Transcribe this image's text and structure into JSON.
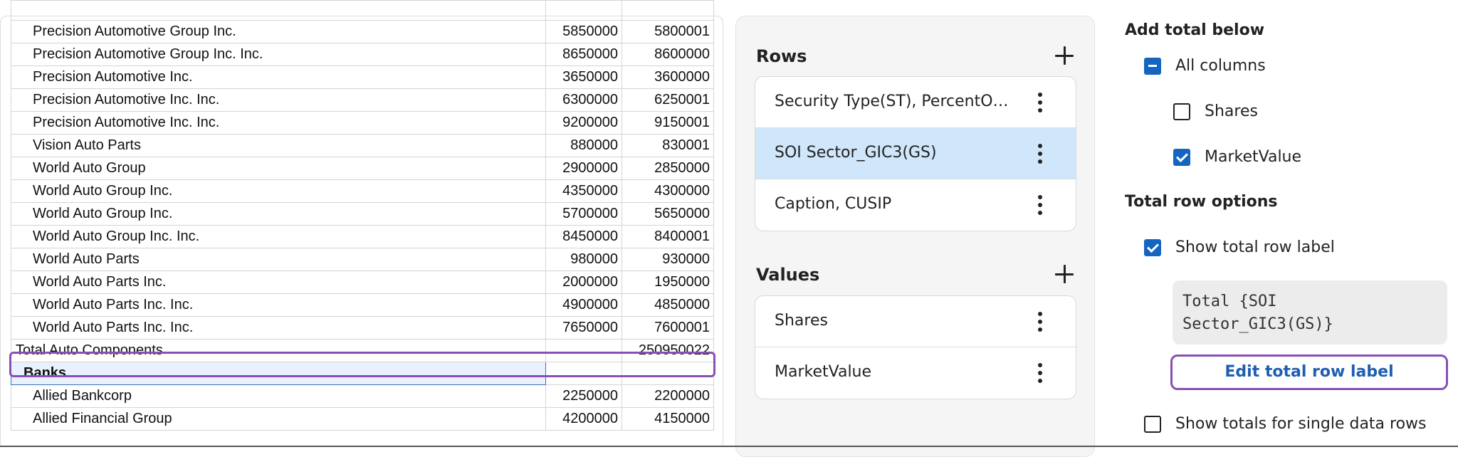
{
  "table": {
    "partial_row": {
      "name": "",
      "shares": "",
      "market_value": ""
    },
    "rows": [
      {
        "name": "Precision Automotive Group Inc.",
        "shares": "5850000",
        "market_value": "5800001"
      },
      {
        "name": "Precision Automotive Group Inc. Inc.",
        "shares": "8650000",
        "market_value": "8600000"
      },
      {
        "name": "Precision Automotive Inc.",
        "shares": "3650000",
        "market_value": "3600000"
      },
      {
        "name": "Precision Automotive Inc. Inc.",
        "shares": "6300000",
        "market_value": "6250001"
      },
      {
        "name": "Precision Automotive Inc. Inc.",
        "shares": "9200000",
        "market_value": "9150001"
      },
      {
        "name": "Vision Auto Parts",
        "shares": "880000",
        "market_value": "830001"
      },
      {
        "name": "World Auto Group",
        "shares": "2900000",
        "market_value": "2850000"
      },
      {
        "name": "World Auto Group Inc.",
        "shares": "4350000",
        "market_value": "4300000"
      },
      {
        "name": "World Auto Group Inc.",
        "shares": "5700000",
        "market_value": "5650000"
      },
      {
        "name": "World Auto Group Inc. Inc.",
        "shares": "8450000",
        "market_value": "8400001"
      },
      {
        "name": "World Auto Parts",
        "shares": "980000",
        "market_value": "930000"
      },
      {
        "name": "World Auto Parts Inc.",
        "shares": "2000000",
        "market_value": "1950000"
      },
      {
        "name": "World Auto Parts Inc. Inc.",
        "shares": "4900000",
        "market_value": "4850000"
      },
      {
        "name": "World Auto Parts Inc. Inc.",
        "shares": "7650000",
        "market_value": "7600001"
      }
    ],
    "total_row": {
      "name": "Total Auto Components",
      "shares": "",
      "market_value": "250950022"
    },
    "group_row": {
      "name": "Banks"
    },
    "after_rows": [
      {
        "name": "Allied Bankcorp",
        "shares": "2250000",
        "market_value": "2200000"
      },
      {
        "name": "Allied Financial Group",
        "shares": "4200000",
        "market_value": "4150000"
      }
    ]
  },
  "config": {
    "rows_title": "Rows",
    "rows": [
      {
        "label": "Security Type(ST), PercentOfNetAssets",
        "selected": false
      },
      {
        "label": "SOI Sector_GIC3(GS)",
        "selected": true
      },
      {
        "label": "Caption, CUSIP",
        "selected": false
      }
    ],
    "values_title": "Values",
    "values": [
      {
        "label": "Shares"
      },
      {
        "label": "MarketValue"
      }
    ]
  },
  "options": {
    "add_total_heading": "Add total below",
    "all_columns_label": "All columns",
    "all_columns_state": "indeterminate",
    "shares_label": "Shares",
    "shares_checked": false,
    "market_value_label": "MarketValue",
    "market_value_checked": true,
    "total_row_heading": "Total row options",
    "show_total_label": "Show total row label",
    "show_total_checked": true,
    "label_template": "Total {SOI\nSector_GIC3(GS)}",
    "edit_button_label": "Edit total row label",
    "single_rows_label": "Show totals for single data rows",
    "single_rows_checked": false
  },
  "colors": {
    "accent": "#1565c0",
    "highlight": "#8a4fb5",
    "selected_row": "#cfe6fb"
  }
}
